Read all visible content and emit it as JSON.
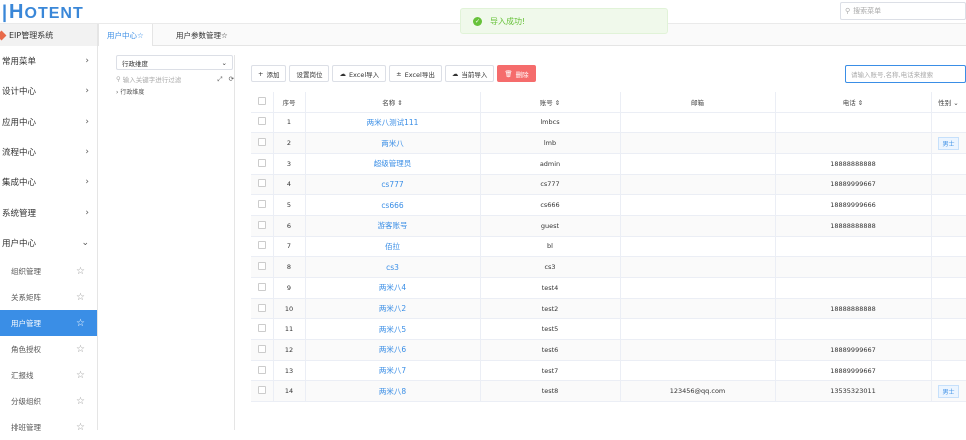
{
  "app": {
    "logo_mark": "|",
    "logo_h": "H",
    "logo_rest": "OTENT"
  },
  "top_search": {
    "placeholder": "搜索菜单"
  },
  "toast": {
    "message": "导入成功!"
  },
  "sidebar": {
    "system_title": "EIP管理系统",
    "items": [
      {
        "label": "常用菜单"
      },
      {
        "label": "设计中心"
      },
      {
        "label": "应用中心"
      },
      {
        "label": "流程中心"
      },
      {
        "label": "集成中心"
      },
      {
        "label": "系统管理"
      },
      {
        "label": "用户中心"
      }
    ],
    "sub_items": [
      {
        "label": "组织管理"
      },
      {
        "label": "关系矩阵"
      },
      {
        "label": "用户管理"
      },
      {
        "label": "角色授权"
      },
      {
        "label": "汇报线"
      },
      {
        "label": "分级组织"
      },
      {
        "label": "排班管理"
      }
    ]
  },
  "tabs": [
    {
      "label": "用户中心☆"
    },
    {
      "label": "用户参数管理☆"
    }
  ],
  "tree": {
    "select_value": "行政维度",
    "search_placeholder": "输入关键字进行过滤",
    "root_node": "行政维度"
  },
  "toolbar": {
    "add": "添加",
    "set_post": "设置岗位",
    "excel_import": "Excel导入",
    "excel_export": "Excel导出",
    "sync_import": "当前导入",
    "delete": "删除"
  },
  "table_search": {
    "placeholder": "请输入账号,名称,电话来搜索"
  },
  "table": {
    "columns": [
      "序号",
      "名称 ⇕",
      "账号 ⇕",
      "邮箱",
      "电话 ⇕",
      "性别 ⌄"
    ],
    "rows": [
      {
        "no": "1",
        "name": "两米八测试111",
        "account": "lmbcs",
        "email": "",
        "phone": "",
        "gender": ""
      },
      {
        "no": "2",
        "name": "两米八",
        "account": "lmb",
        "email": "",
        "phone": "",
        "gender": "男士"
      },
      {
        "no": "3",
        "name": "超级管理员",
        "account": "admin",
        "email": "",
        "phone": "18888888888",
        "gender": ""
      },
      {
        "no": "4",
        "name": "cs777",
        "account": "cs777",
        "email": "",
        "phone": "18889999667",
        "gender": ""
      },
      {
        "no": "5",
        "name": "cs666",
        "account": "cs666",
        "email": "",
        "phone": "18889999666",
        "gender": ""
      },
      {
        "no": "6",
        "name": "游客账号",
        "account": "guest",
        "email": "",
        "phone": "18888888888",
        "gender": ""
      },
      {
        "no": "7",
        "name": "佰拉",
        "account": "bl",
        "email": "",
        "phone": "",
        "gender": ""
      },
      {
        "no": "8",
        "name": "cs3",
        "account": "cs3",
        "email": "",
        "phone": "",
        "gender": ""
      },
      {
        "no": "9",
        "name": "两米八4",
        "account": "test4",
        "email": "",
        "phone": "",
        "gender": ""
      },
      {
        "no": "10",
        "name": "两米八2",
        "account": "test2",
        "email": "",
        "phone": "18888888888",
        "gender": ""
      },
      {
        "no": "11",
        "name": "两米八5",
        "account": "test5",
        "email": "",
        "phone": "",
        "gender": ""
      },
      {
        "no": "12",
        "name": "两米八6",
        "account": "test6",
        "email": "",
        "phone": "18889999667",
        "gender": ""
      },
      {
        "no": "13",
        "name": "两米八7",
        "account": "test7",
        "email": "",
        "phone": "18889999667",
        "gender": ""
      },
      {
        "no": "14",
        "name": "两米八8",
        "account": "test8",
        "email": "123456@qq.com",
        "phone": "13535323011",
        "gender": "男士"
      }
    ]
  },
  "colors": {
    "accent": "#3a8ee6",
    "danger": "#f56c6c",
    "success": "#67c23a"
  }
}
